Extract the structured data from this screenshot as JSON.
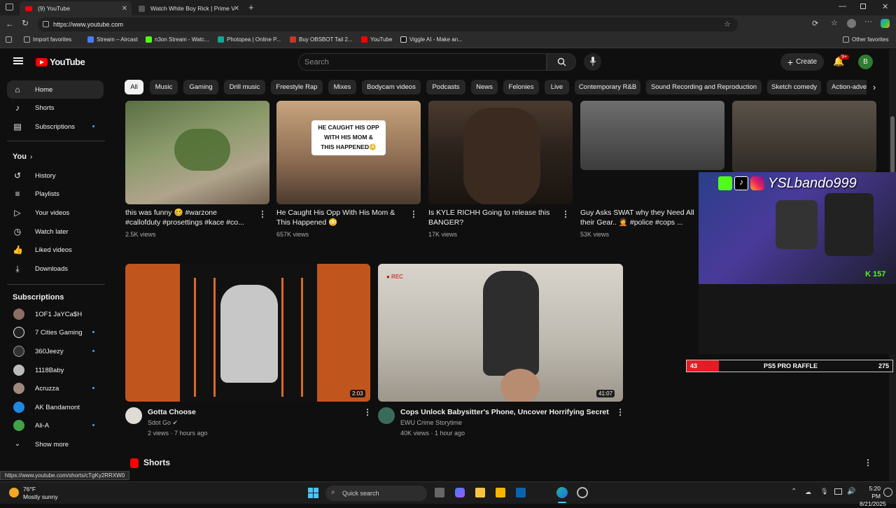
{
  "browser": {
    "tabs": [
      {
        "title": "(9) YouTube",
        "active": true
      },
      {
        "title": "Watch White Boy Rick | Prime Vid",
        "active": false
      }
    ],
    "url": "https://www.youtube.com",
    "bookmarks": [
      "Import favorites",
      "Stream – Aircast",
      "n3on Stream - Watc...",
      "Photopea | Online P...",
      "Buy OBSBOT Tail 2...",
      "YouTube",
      "Viggle AI - Make an..."
    ],
    "other_favorites": "Other favorites",
    "status_url": "https://www.youtube.com/shorts/cTgKy2RRXW0"
  },
  "youtube": {
    "logo_text": "YouTube",
    "search_placeholder": "Search",
    "create_label": "Create",
    "notif_badge": "9+",
    "avatar_letter": "B",
    "sidebar": {
      "main": [
        "Home",
        "Shorts",
        "Subscriptions"
      ],
      "you_heading": "You",
      "you_items": [
        "History",
        "Playlists",
        "Your videos",
        "Watch later",
        "Liked videos",
        "Downloads"
      ],
      "subs_heading": "Subscriptions",
      "subs": [
        "1OF1 JaYCa$H",
        "7 Cities Gaming",
        "360Jeezy",
        "1118Baby",
        "Acruzza",
        "AK Bandamont",
        "Ali-A"
      ],
      "show_more": "Show more"
    },
    "chips": [
      "All",
      "Music",
      "Gaming",
      "Drill music",
      "Freestyle Rap",
      "Mixes",
      "Bodycam videos",
      "Podcasts",
      "News",
      "Felonies",
      "Live",
      "Contemporary R&B",
      "Sound Recording and Reproduction",
      "Sketch comedy",
      "Action-adve"
    ],
    "row1": [
      {
        "title1": "this was funny 🥴 #warzone",
        "title2": "#callofduty #prosettings #kace #co...",
        "views": "2.5K views"
      },
      {
        "title1": "He Caught His Opp With His Mom &",
        "title2": "This Happened 😳",
        "views": "657K views",
        "thumb_text": [
          "HE CAUGHT HIS OPP",
          "WITH HIS MOM &",
          "THIS HAPPENED😳"
        ]
      },
      {
        "title1": "Is KYLE RICHH  Going to release this",
        "title2": "BANGER?",
        "views": "17K views"
      },
      {
        "title1": "Guy Asks SWAT why they Need All",
        "title2": "their Gear.. 🤦 #police #cops ...",
        "views": "53K views"
      }
    ],
    "row2": [
      {
        "title": "Gotta Choose",
        "channel": "Sdot Go",
        "meta": "2 views · 7 hours ago",
        "duration": "2:03"
      },
      {
        "title": "Cops Unlock Babysitter's Phone, Uncover Horrifying Secret",
        "channel": "EWU Crime Storytime",
        "meta": "40K views · 1 hour ago",
        "duration": "41:07"
      }
    ],
    "shorts_heading": "Shorts"
  },
  "overlay": {
    "handle": "YSLbando999",
    "raffle_left": "43",
    "raffle_label": "PS5 PRO RAFFLE",
    "raffle_right": "275",
    "kick_count": "157"
  },
  "taskbar": {
    "weather_temp": "76°F",
    "weather_desc": "Mostly sunny",
    "search_label": "Quick search",
    "time": "5:20 PM",
    "date": "8/21/2025"
  }
}
